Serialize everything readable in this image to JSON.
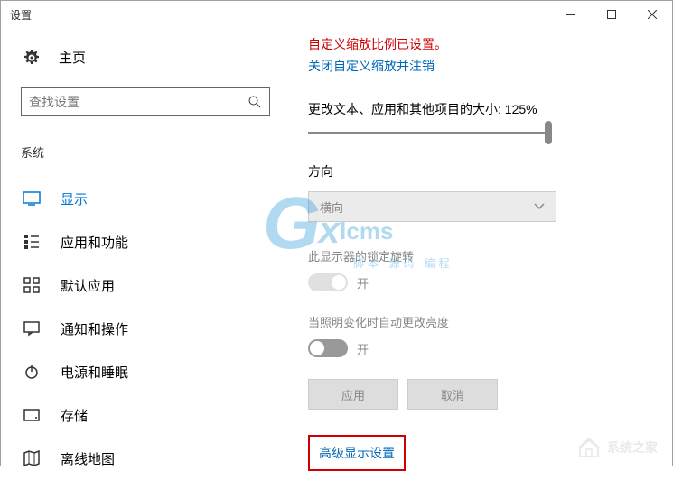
{
  "window": {
    "title": "设置"
  },
  "sidebar": {
    "home": "主页",
    "search_placeholder": "查找设置",
    "section": "系统",
    "items": [
      {
        "label": "显示",
        "icon": "monitor",
        "active": true
      },
      {
        "label": "应用和功能",
        "icon": "apps"
      },
      {
        "label": "默认应用",
        "icon": "defaults"
      },
      {
        "label": "通知和操作",
        "icon": "notifications"
      },
      {
        "label": "电源和睡眠",
        "icon": "power"
      },
      {
        "label": "存储",
        "icon": "storage"
      },
      {
        "label": "离线地图",
        "icon": "maps"
      }
    ]
  },
  "main": {
    "warning": "自定义缩放比例已设置。",
    "turnoff_link": "关闭自定义缩放并注销",
    "scale_label": "更改文本、应用和其他项目的大小: 125%",
    "orientation_title": "方向",
    "orientation_value": "横向",
    "lock_rotation_label": "此显示器的锁定旋转",
    "lock_rotation_state": "开",
    "brightness_label": "当照明变化时自动更改亮度",
    "brightness_state": "开",
    "apply_btn": "应用",
    "cancel_btn": "取消",
    "advanced_link": "高级显示设置"
  },
  "watermark": {
    "main": "Gxlcms",
    "sub": "脚本 源码 编程",
    "corner": "系统之家"
  }
}
